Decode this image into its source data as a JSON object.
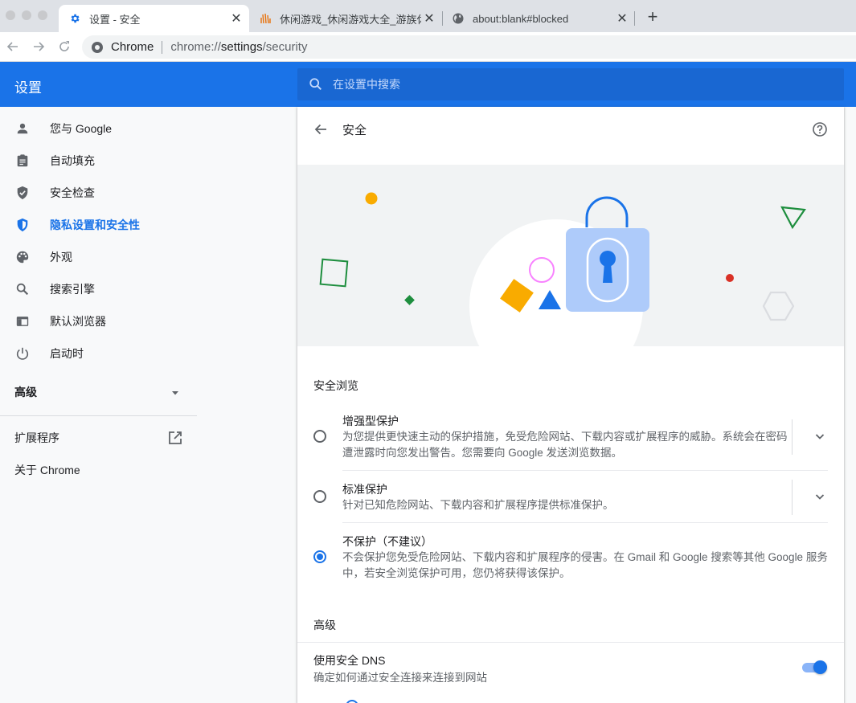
{
  "browser": {
    "tabs": [
      {
        "title": "设置 - 安全",
        "icon": "gear-icon",
        "active": true
      },
      {
        "title": "休闲游戏_休闲游戏大全_游族休闲",
        "icon": "hand-logo-icon",
        "active": false
      },
      {
        "title": "about:blank#blocked",
        "icon": "globe-icon",
        "active": false
      }
    ],
    "new_tab_label": "+",
    "omnibox": {
      "site_label": "Chrome",
      "url_prefix": "chrome://",
      "url_host": "settings",
      "url_path": "/security"
    }
  },
  "header": {
    "title": "设置",
    "search_placeholder": "在设置中搜索"
  },
  "sidebar": {
    "items": [
      {
        "label": "您与 Google",
        "icon": "person-icon"
      },
      {
        "label": "自动填充",
        "icon": "clipboard-icon"
      },
      {
        "label": "安全检查",
        "icon": "shield-check-icon"
      },
      {
        "label": "隐私设置和安全性",
        "icon": "privacy-shield-icon",
        "selected": true
      },
      {
        "label": "外观",
        "icon": "palette-icon"
      },
      {
        "label": "搜索引擎",
        "icon": "search-icon"
      },
      {
        "label": "默认浏览器",
        "icon": "browser-window-icon"
      },
      {
        "label": "启动时",
        "icon": "power-icon"
      }
    ],
    "advanced_label": "高级",
    "extensions_label": "扩展程序",
    "about_label": "关于 Chrome"
  },
  "page": {
    "title": "安全",
    "safe_browsing_heading": "安全浏览",
    "options": [
      {
        "label": "增强型保护",
        "description": "为您提供更快速主动的保护措施，免受危险网站、下载内容或扩展程序的威胁。系统会在密码遭泄露时向您发出警告。您需要向 Google 发送浏览数据。",
        "selected": false
      },
      {
        "label": "标准保护",
        "description": "针对已知危险网站、下载内容和扩展程序提供标准保护。",
        "selected": false
      },
      {
        "label": "不保护（不建议）",
        "description": "不会保护您免受危险网站、下载内容和扩展程序的侵害。在 Gmail 和 Google 搜索等其他 Google 服务中，若安全浏览保护可用，您仍将获得该保护。",
        "selected": true
      }
    ],
    "advanced_heading": "高级",
    "secure_dns": {
      "label": "使用安全 DNS",
      "description": "确定如何通过安全连接来连接到网站",
      "enabled": true
    }
  },
  "colors": {
    "accent": "#1a73e8",
    "header_bg": "#1a73e8"
  }
}
